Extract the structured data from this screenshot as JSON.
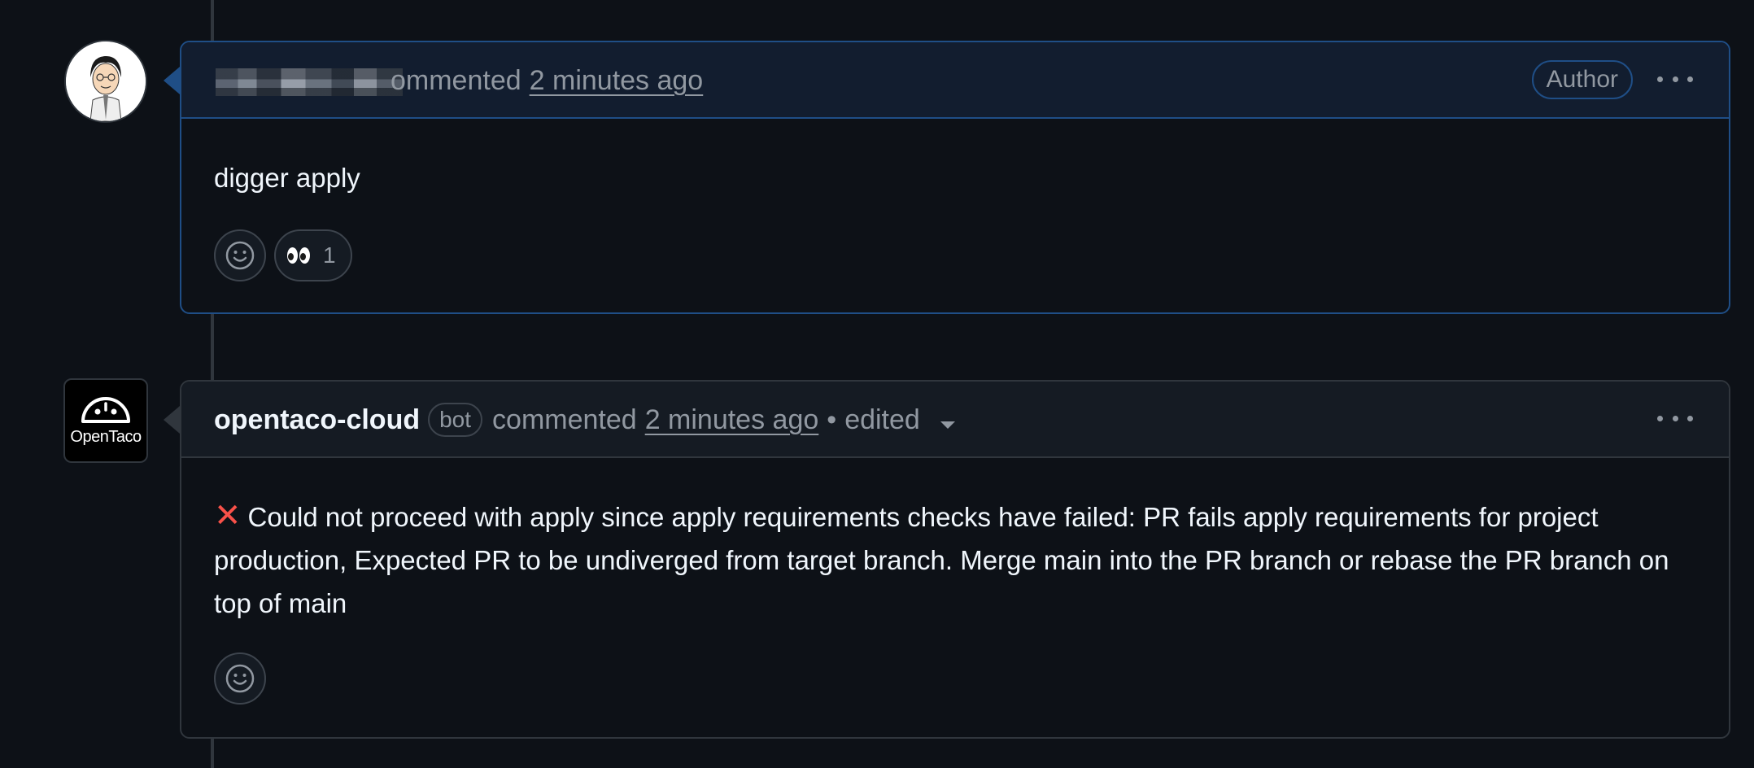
{
  "comments": [
    {
      "author": "",
      "action": "ommented",
      "time": "2 minutes ago",
      "badge": "Author",
      "body": "digger apply",
      "reactions": [
        {
          "icon": "eyes-emoji",
          "count": "1"
        }
      ]
    },
    {
      "author": "opentaco-cloud",
      "bot_label": "bot",
      "action": "commented",
      "time": "2 minutes ago",
      "separator": "•",
      "edited": "edited",
      "status_icon": "red-x-icon",
      "body": "Could not proceed with apply since apply requirements checks have failed: PR fails apply requirements for project production, Expected PR to be undiverged from target branch. Merge main into the PR branch or rebase the PR branch on top of main",
      "reactions": []
    }
  ],
  "bot_avatar": {
    "brand": "OpenTaco"
  },
  "colors": {
    "background": "#0d1117",
    "author_border": "#1f4e86",
    "author_header": "#121d2f",
    "default_border": "#30363d",
    "muted_text": "#9198a1",
    "error_red": "#f85149"
  }
}
